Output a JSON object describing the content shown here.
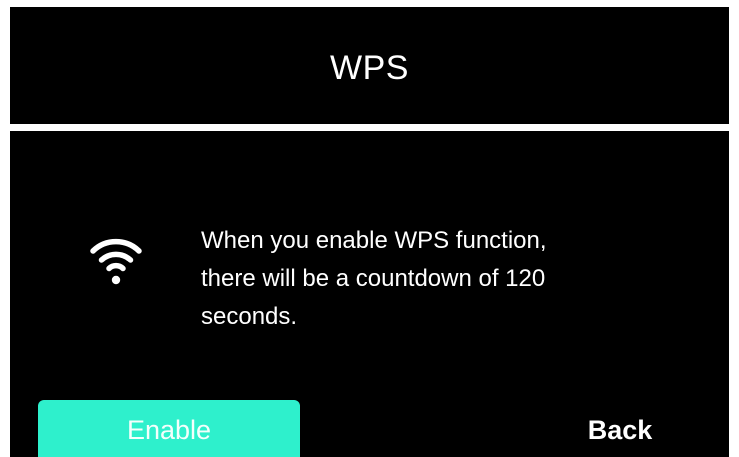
{
  "header": {
    "title": "WPS"
  },
  "dialog": {
    "icon": "wifi-icon",
    "message": "When you enable WPS function,\nthere will be a countdown of 120\nseconds."
  },
  "buttons": {
    "enable_label": "Enable",
    "back_label": "Back"
  },
  "colors": {
    "background": "#000000",
    "text": "#ffffff",
    "accent": "#2ef0cc",
    "divider": "#ffffff"
  }
}
